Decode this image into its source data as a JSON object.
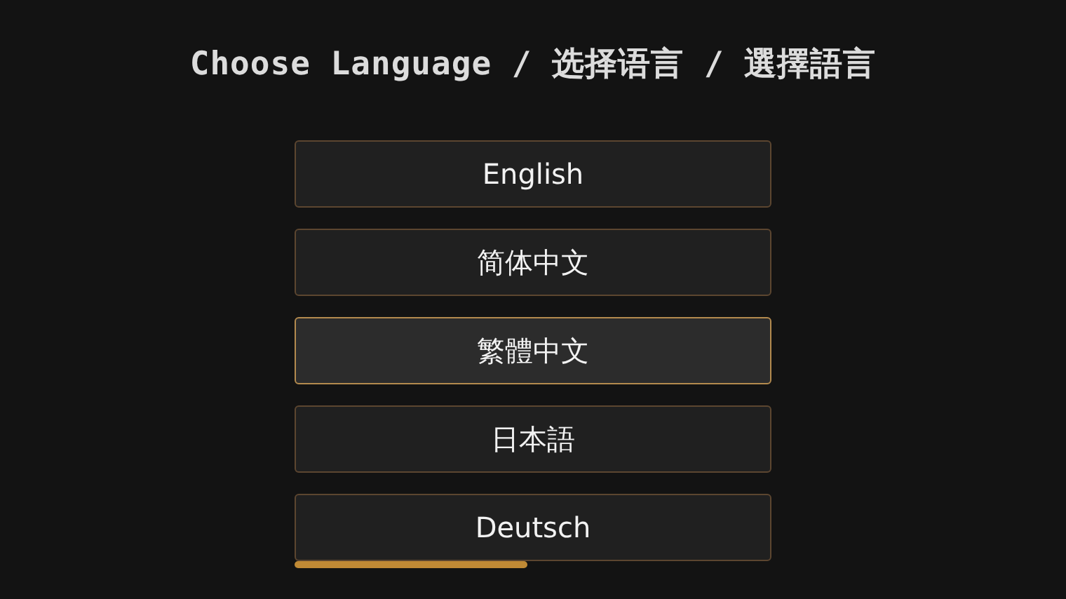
{
  "title": "Choose Language / 选择语言 / 選擇語言",
  "languages": [
    {
      "label": "English",
      "selected": false
    },
    {
      "label": "简体中文",
      "selected": false
    },
    {
      "label": "繁體中文",
      "selected": true
    },
    {
      "label": "日本語",
      "selected": false
    },
    {
      "label": "Deutsch",
      "selected": false
    }
  ]
}
